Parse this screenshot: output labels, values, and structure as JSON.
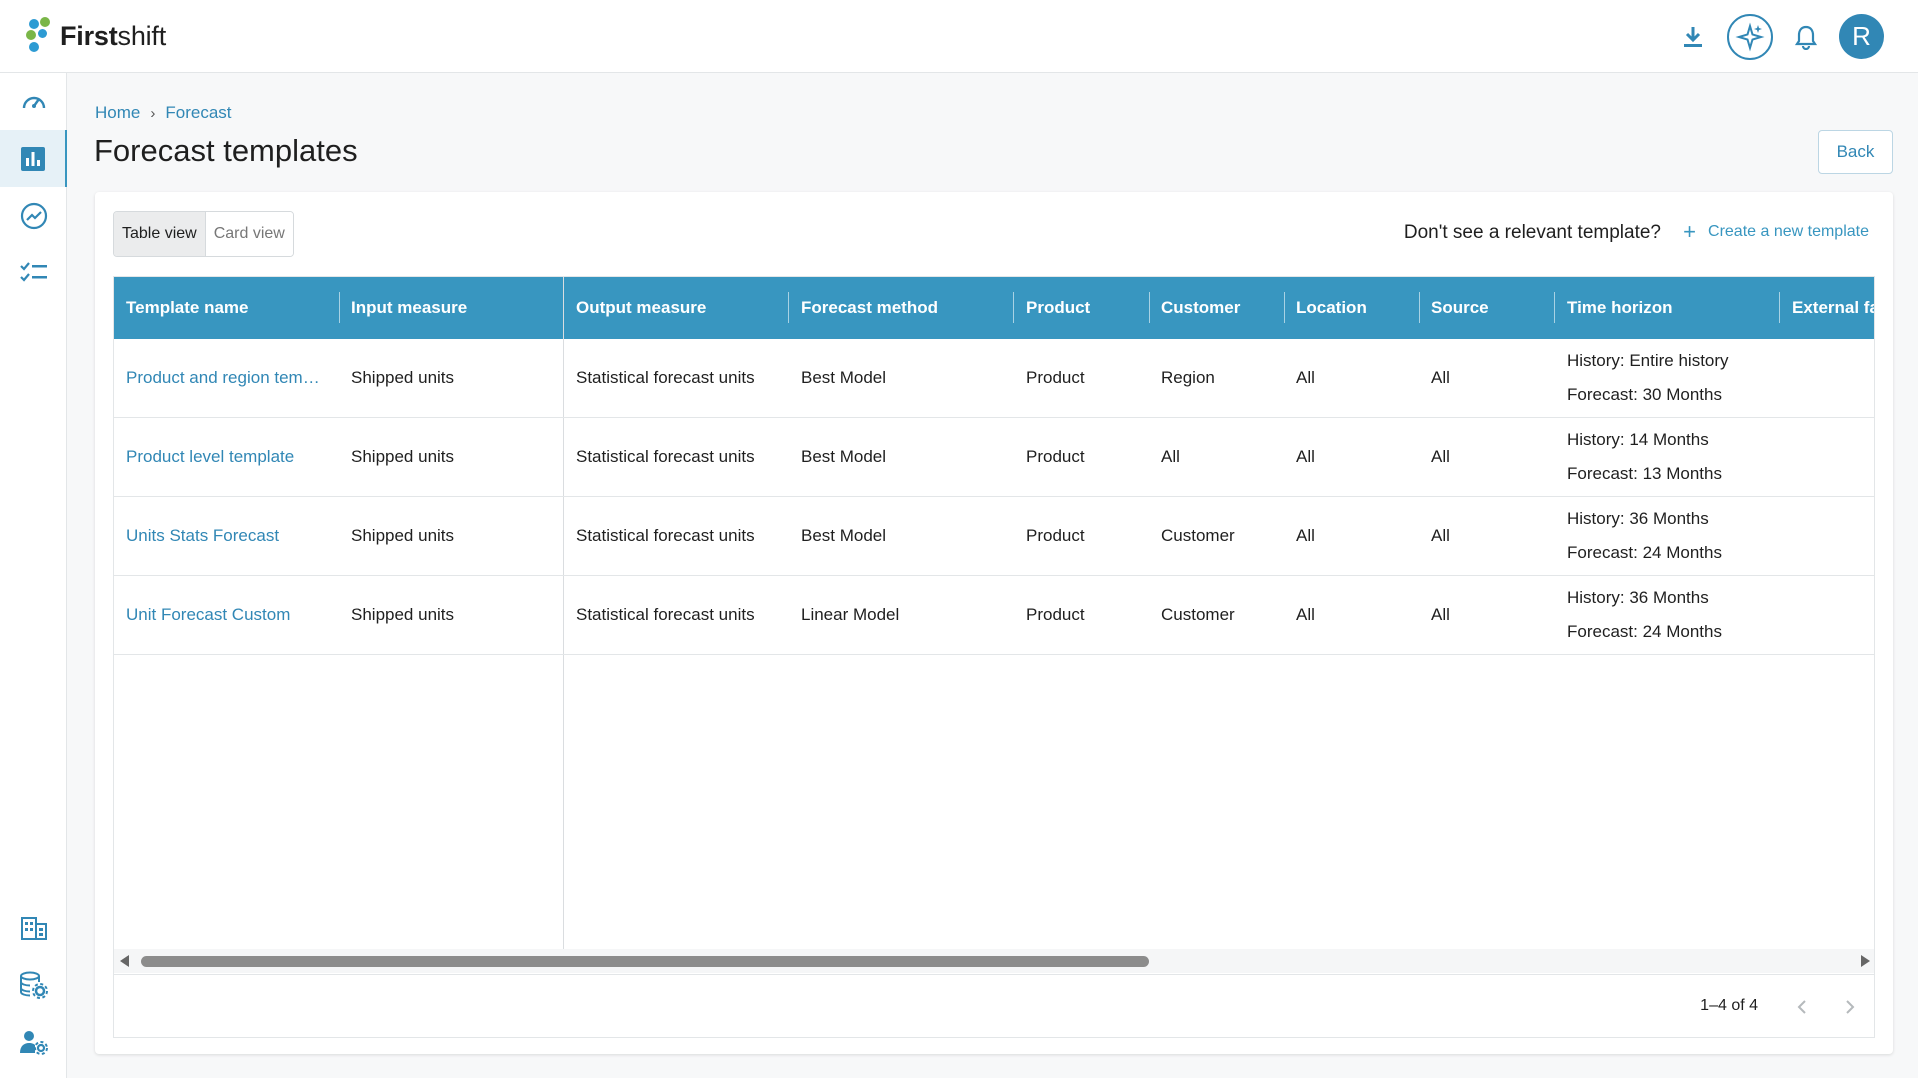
{
  "app": {
    "brand_bold": "First",
    "brand_rest": "shift",
    "avatar_initial": "R",
    "accent": "#3896c0"
  },
  "header_icons": [
    "download-icon",
    "ai-sparkle-icon",
    "bell-icon",
    "user-avatar"
  ],
  "sidebar": [
    "dashboard-icon",
    "bar-chart-icon",
    "trend-icon",
    "checklist-icon",
    "building-icon",
    "database-settings-icon",
    "user-settings-icon"
  ],
  "breadcrumb": {
    "home": "Home",
    "current": "Forecast",
    "separator": "›"
  },
  "page": {
    "title": "Forecast templates",
    "back_label": "Back"
  },
  "view_toggle": {
    "table": "Table view",
    "card": "Card view"
  },
  "prompt": {
    "text": "Don't see a relevant template?",
    "create_plus": "+",
    "create_label": "Create a new template"
  },
  "table": {
    "columns": [
      "Template name",
      "Input measure",
      "Output measure",
      "Forecast method",
      "Product",
      "Customer",
      "Location",
      "Source",
      "Time horizon",
      "External fa"
    ],
    "rows": [
      {
        "name": "Product and region tem…",
        "input": "Shipped units",
        "output": "Statistical forecast units",
        "method": "Best Model",
        "product": "Product",
        "customer": "Region",
        "location": "All",
        "source": "All",
        "history": "History: Entire history",
        "forecast": "Forecast: 30 Months"
      },
      {
        "name": "Product level template",
        "input": "Shipped units",
        "output": "Statistical forecast units",
        "method": "Best Model",
        "product": "Product",
        "customer": "All",
        "location": "All",
        "source": "All",
        "history": "History: 14 Months",
        "forecast": "Forecast: 13 Months"
      },
      {
        "name": "Units Stats Forecast",
        "input": "Shipped units",
        "output": "Statistical forecast units",
        "method": "Best Model",
        "product": "Product",
        "customer": "Customer",
        "location": "All",
        "source": "All",
        "history": "History: 36 Months",
        "forecast": "Forecast: 24 Months"
      },
      {
        "name": "Unit Forecast Custom",
        "input": "Shipped units",
        "output": "Statistical forecast units",
        "method": "Linear Model",
        "product": "Product",
        "customer": "Customer",
        "location": "All",
        "source": "All",
        "history": "History: 36 Months",
        "forecast": "Forecast: 24 Months"
      }
    ]
  },
  "pagination": {
    "text": "1–4 of 4"
  }
}
